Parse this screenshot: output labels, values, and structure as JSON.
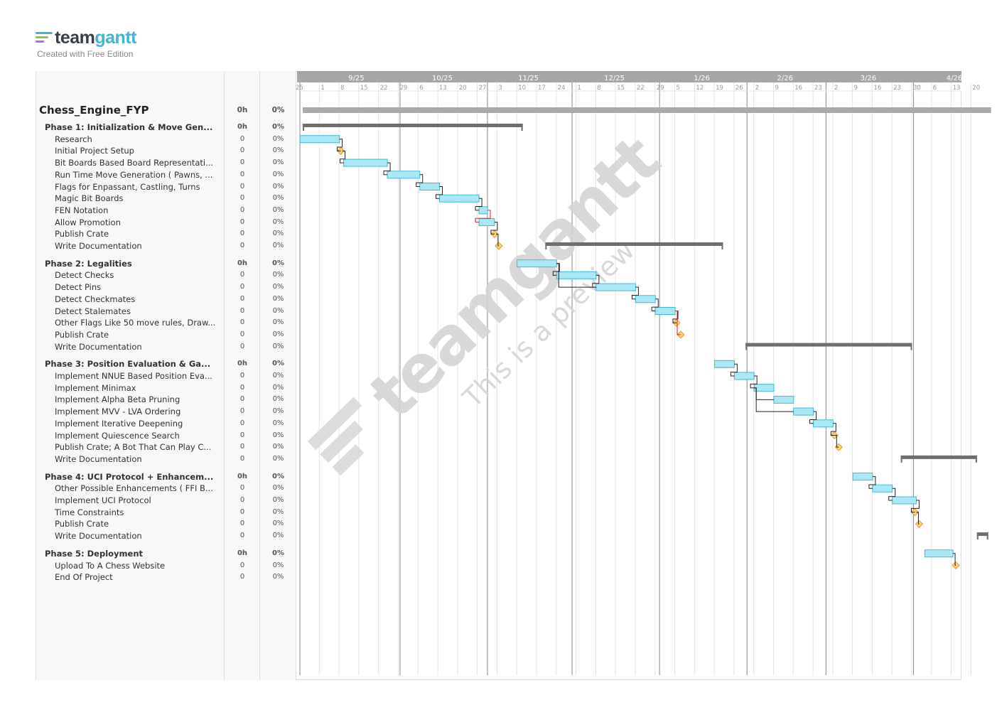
{
  "brand": {
    "name_part1": "team",
    "name_part2": "gantt",
    "subtitle": "Created with Free Edition",
    "colors": {
      "dark": "#3a3f47",
      "accent": "#3fb6cf",
      "green": "#8dc63f",
      "purple": "#b36ad8"
    }
  },
  "watermark": {
    "logo_text": "teamgantt",
    "caption": "This is a preview"
  },
  "timeline": {
    "months": [
      "9/25",
      "10/25",
      "11/25",
      "12/25",
      "1/26",
      "2/26",
      "3/26",
      "4/26"
    ],
    "weeks": [
      "1",
      "8",
      "15",
      "22",
      "29",
      "6",
      "13",
      "20",
      "27",
      "3",
      "10",
      "17",
      "24",
      "1",
      "8",
      "15",
      "22",
      "29",
      "5",
      "12",
      "19",
      "26",
      "2",
      "9",
      "16",
      "23",
      "2",
      "9",
      "16",
      "23",
      "30",
      "6",
      "13",
      "20"
    ],
    "start_tick_label": "25"
  },
  "project": {
    "name": "Chess_Engine_FYP",
    "hours": "0h",
    "percent": "0%"
  },
  "rows": [
    {
      "label": "Phase 1: Initialization & Move Gen...",
      "hours": "0h",
      "pct": "0%",
      "type": "group"
    },
    {
      "label": "Research",
      "hours": "0",
      "pct": "0%",
      "type": "task"
    },
    {
      "label": "Initial Project Setup",
      "hours": "0",
      "pct": "0%",
      "type": "milestone"
    },
    {
      "label": "Bit Boards Based Board Representati...",
      "hours": "0",
      "pct": "0%",
      "type": "task"
    },
    {
      "label": "Run Time Move Generation ( Pawns, ...",
      "hours": "0",
      "pct": "0%",
      "type": "task"
    },
    {
      "label": "Flags for Enpassant, Castling, Turns",
      "hours": "0",
      "pct": "0%",
      "type": "task"
    },
    {
      "label": "Magic Bit Boards",
      "hours": "0",
      "pct": "0%",
      "type": "task"
    },
    {
      "label": "FEN Notation",
      "hours": "0",
      "pct": "0%",
      "type": "task"
    },
    {
      "label": "Allow Promotion",
      "hours": "0",
      "pct": "0%",
      "type": "task"
    },
    {
      "label": "Publish Crate",
      "hours": "0",
      "pct": "0%",
      "type": "milestone"
    },
    {
      "label": "Write Documentation",
      "hours": "0",
      "pct": "0%",
      "type": "milestone"
    },
    {
      "label": "Phase 2: Legalities",
      "hours": "0h",
      "pct": "0%",
      "type": "group"
    },
    {
      "label": "Detect Checks",
      "hours": "0",
      "pct": "0%",
      "type": "task"
    },
    {
      "label": "Detect Pins",
      "hours": "0",
      "pct": "0%",
      "type": "task"
    },
    {
      "label": "Detect Checkmates",
      "hours": "0",
      "pct": "0%",
      "type": "task"
    },
    {
      "label": "Detect Stalemates",
      "hours": "0",
      "pct": "0%",
      "type": "task"
    },
    {
      "label": "Other Flags Like 50 move rules, Draw...",
      "hours": "0",
      "pct": "0%",
      "type": "task"
    },
    {
      "label": "Publish Crate",
      "hours": "0",
      "pct": "0%",
      "type": "milestone"
    },
    {
      "label": "Write Documentation",
      "hours": "0",
      "pct": "0%",
      "type": "milestone"
    },
    {
      "label": "Phase 3: Position Evaluation & Ga...",
      "hours": "0h",
      "pct": "0%",
      "type": "group"
    },
    {
      "label": "Implement NNUE Based Position Eva...",
      "hours": "0",
      "pct": "0%",
      "type": "task"
    },
    {
      "label": "Implement Minimax",
      "hours": "0",
      "pct": "0%",
      "type": "task"
    },
    {
      "label": "Implement Alpha Beta Pruning",
      "hours": "0",
      "pct": "0%",
      "type": "task"
    },
    {
      "label": "Implement MVV - LVA Ordering",
      "hours": "0",
      "pct": "0%",
      "type": "task"
    },
    {
      "label": "Implement Iterative Deepening",
      "hours": "0",
      "pct": "0%",
      "type": "task"
    },
    {
      "label": "Implement Quiescence Search",
      "hours": "0",
      "pct": "0%",
      "type": "task"
    },
    {
      "label": "Publish Crate; A Bot That Can Play C...",
      "hours": "0",
      "pct": "0%",
      "type": "milestone"
    },
    {
      "label": "Write Documentation",
      "hours": "0",
      "pct": "0%",
      "type": "milestone"
    },
    {
      "label": "Phase 4: UCI Protocol + Enhancem...",
      "hours": "0h",
      "pct": "0%",
      "type": "group"
    },
    {
      "label": "Other Possible Enhancements ( FFI B...",
      "hours": "0",
      "pct": "0%",
      "type": "task"
    },
    {
      "label": "Implement UCI Protocol",
      "hours": "0",
      "pct": "0%",
      "type": "task"
    },
    {
      "label": "Time Constraints",
      "hours": "0",
      "pct": "0%",
      "type": "task"
    },
    {
      "label": "Publish Crate",
      "hours": "0",
      "pct": "0%",
      "type": "milestone"
    },
    {
      "label": "Write Documentation",
      "hours": "0",
      "pct": "0%",
      "type": "milestone"
    },
    {
      "label": "Phase 5: Deployment",
      "hours": "0h",
      "pct": "0%",
      "type": "group"
    },
    {
      "label": "Upload To A Chess Website",
      "hours": "0",
      "pct": "0%",
      "type": "task"
    },
    {
      "label": "End Of Project",
      "hours": "0",
      "pct": "0%",
      "type": "milestone"
    }
  ],
  "schedule_dates": {
    "project": [
      "2025-08-26",
      "2026-04-26"
    ],
    "phase1": [
      "2025-08-26",
      "2025-11-12"
    ],
    "phase2": [
      "2025-11-20",
      "2026-01-22"
    ],
    "phase3": [
      "2026-01-30",
      "2026-03-30"
    ],
    "phase4": [
      "2026-03-26",
      "2026-04-22"
    ],
    "phase5": [
      "2026-04-22",
      "2026-04-26"
    ]
  },
  "colors": {
    "task_fill": "#a9e8f4",
    "task_border": "#45b8d0",
    "group_bar": "#6e6e6e",
    "project_bar": "#aaaaaa",
    "milestone_fill": "#ffd27a",
    "milestone_border": "#e0a030",
    "dependency": "#222222",
    "dependency_late": "#e02020",
    "header_bg": "#a6a6a6"
  }
}
